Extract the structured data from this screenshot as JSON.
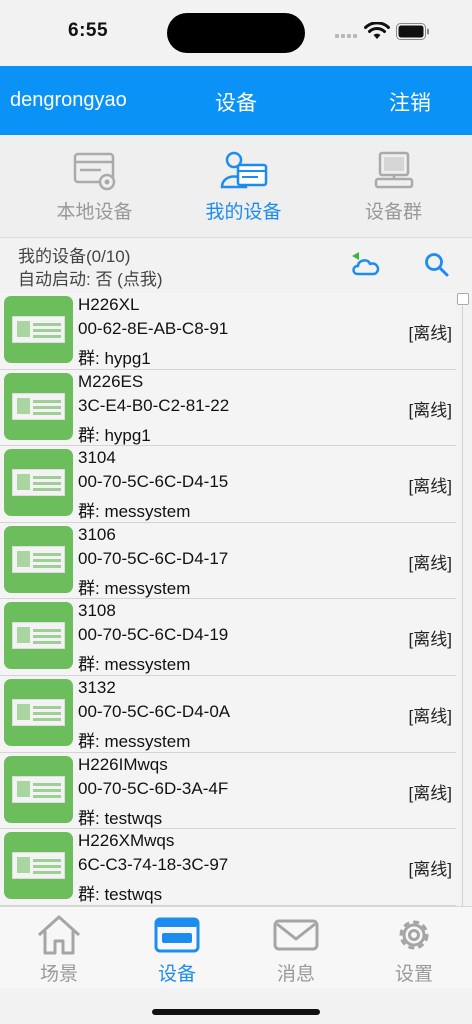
{
  "status_bar": {
    "time": "6:55"
  },
  "header": {
    "username": "dengrongyao",
    "title": "设备",
    "logout": "注销"
  },
  "segments": [
    {
      "label": "本地设备",
      "icon": "local-device-icon",
      "active": false
    },
    {
      "label": "我的设备",
      "icon": "my-device-icon",
      "active": true
    },
    {
      "label": "设备群",
      "icon": "device-group-icon",
      "active": false
    }
  ],
  "info": {
    "count_text": "我的设备(0/10)",
    "auto_start_text": "自动启动: 否 (点我)"
  },
  "devices": [
    {
      "name": "H226XL",
      "mac": "00-62-8E-AB-C8-91",
      "group": "群: hypg1",
      "status": "[离线]"
    },
    {
      "name": "M226ES",
      "mac": "3C-E4-B0-C2-81-22",
      "group": "群: hypg1",
      "status": "[离线]"
    },
    {
      "name": "3104",
      "mac": "00-70-5C-6C-D4-15",
      "group": "群: messystem",
      "status": "[离线]"
    },
    {
      "name": "3106",
      "mac": "00-70-5C-6C-D4-17",
      "group": "群: messystem",
      "status": "[离线]"
    },
    {
      "name": "3108",
      "mac": "00-70-5C-6C-D4-19",
      "group": "群: messystem",
      "status": "[离线]"
    },
    {
      "name": "3132",
      "mac": "00-70-5C-6C-D4-0A",
      "group": "群: messystem",
      "status": "[离线]"
    },
    {
      "name": "H226IMwqs",
      "mac": "00-70-5C-6D-3A-4F",
      "group": "群: testwqs",
      "status": "[离线]"
    },
    {
      "name": "H226XMwqs",
      "mac": "6C-C3-74-18-3C-97",
      "group": "群: testwqs",
      "status": "[离线]"
    }
  ],
  "tabbar": [
    {
      "label": "场景",
      "icon": "home-icon",
      "active": false
    },
    {
      "label": "设备",
      "icon": "device-icon",
      "active": true
    },
    {
      "label": "消息",
      "icon": "mail-icon",
      "active": false
    },
    {
      "label": "设置",
      "icon": "gear-icon",
      "active": false
    }
  ],
  "colors": {
    "header_bg": "#0a92f6",
    "accent": "#1d8cf0",
    "thumb_green": "#6cbd5c"
  }
}
